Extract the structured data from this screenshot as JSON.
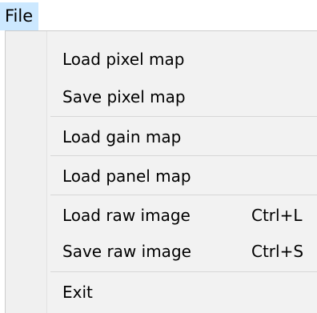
{
  "menubar": {
    "file_label": "File"
  },
  "menu": {
    "items": [
      {
        "label": "Load pixel map",
        "shortcut": ""
      },
      {
        "label": "Save pixel map",
        "shortcut": ""
      },
      {
        "label": "Load gain map",
        "shortcut": ""
      },
      {
        "label": "Load panel map",
        "shortcut": ""
      },
      {
        "label": "Load raw image",
        "shortcut": "Ctrl+L"
      },
      {
        "label": "Save raw image",
        "shortcut": "Ctrl+S"
      },
      {
        "label": "Exit",
        "shortcut": ""
      }
    ]
  },
  "colors": {
    "menu_title_highlight": "#cce8ff",
    "menu_background": "#f2f2f2",
    "separator": "#d7d7d7"
  }
}
